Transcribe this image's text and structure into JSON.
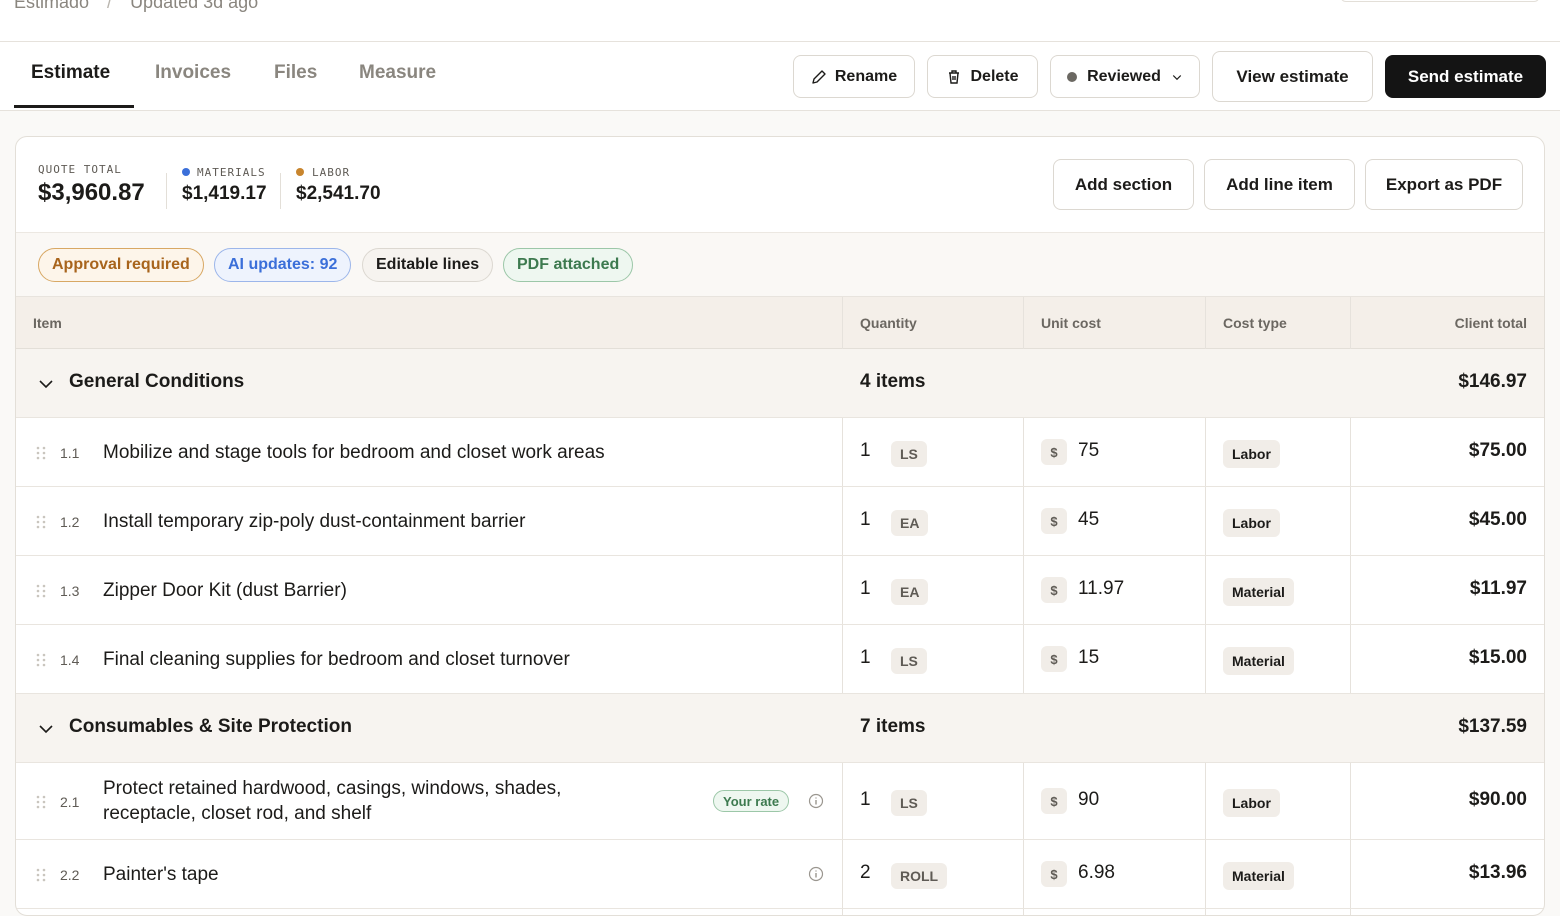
{
  "breadcrumb": {
    "project": "Estimado",
    "separator": "/",
    "updated": "Updated 3d ago"
  },
  "tabs": [
    {
      "label": "Estimate",
      "active": true
    },
    {
      "label": "Invoices",
      "active": false
    },
    {
      "label": "Files",
      "active": false
    },
    {
      "label": "Measure",
      "active": false
    }
  ],
  "actions": {
    "rename": "Rename",
    "delete": "Delete",
    "status": "Reviewed",
    "view": "View estimate",
    "send": "Send estimate"
  },
  "summary": {
    "quote_total_label": "QUOTE TOTAL",
    "quote_total": "$3,960.87",
    "materials_label": "MATERIALS",
    "materials": "$1,419.17",
    "materials_color": "#3b6fd9",
    "labor_label": "LABOR",
    "labor": "$2,541.70",
    "labor_color": "#c8852e",
    "add_section": "Add section",
    "add_line_item": "Add line item",
    "export_pdf": "Export as PDF"
  },
  "chips": {
    "approval": "Approval required",
    "ai_updates": "AI updates: 92",
    "editable": "Editable lines",
    "pdf": "PDF attached"
  },
  "columns": {
    "item": "Item",
    "quantity": "Quantity",
    "unit_cost": "Unit cost",
    "cost_type": "Cost type",
    "client_total": "Client total"
  },
  "sections": [
    {
      "title": "General Conditions",
      "count": "4 items",
      "total": "$146.97",
      "lines": [
        {
          "num": "1.1",
          "desc": "Mobilize and stage tools for bedroom and closet work areas",
          "qty": "1",
          "unit": "LS",
          "cost": "75",
          "type": "Labor",
          "total": "$75.00"
        },
        {
          "num": "1.2",
          "desc": "Install temporary zip-poly dust-containment barrier",
          "qty": "1",
          "unit": "EA",
          "cost": "45",
          "type": "Labor",
          "total": "$45.00"
        },
        {
          "num": "1.3",
          "desc": "Zipper Door Kit (dust Barrier)",
          "qty": "1",
          "unit": "EA",
          "cost": "11.97",
          "type": "Material",
          "total": "$11.97"
        },
        {
          "num": "1.4",
          "desc": "Final cleaning supplies for bedroom and closet turnover",
          "qty": "1",
          "unit": "LS",
          "cost": "15",
          "type": "Material",
          "total": "$15.00"
        }
      ]
    },
    {
      "title": "Consumables & Site Protection",
      "count": "7 items",
      "total": "$137.59",
      "lines": [
        {
          "num": "2.1",
          "desc1": "Protect retained hardwood, casings, windows, shades,",
          "desc2": "receptacle, closet rod, and shelf",
          "badge": "Your rate",
          "qty": "1",
          "unit": "LS",
          "cost": "90",
          "type": "Labor",
          "total": "$90.00"
        },
        {
          "num": "2.2",
          "desc": "Painter's tape",
          "qty": "2",
          "unit": "ROLL",
          "cost": "6.98",
          "type": "Material",
          "total": "$13.96"
        }
      ]
    }
  ],
  "currency_symbol": "$"
}
